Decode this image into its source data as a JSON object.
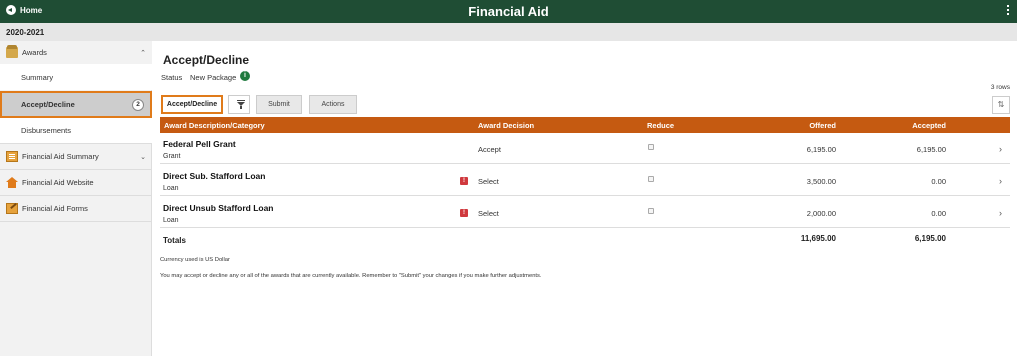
{
  "header": {
    "home_label": "Home",
    "title": "Financial Aid"
  },
  "subheader": {
    "year": "2020-2021"
  },
  "sidebar": {
    "awards_label": "Awards",
    "summary_label": "Summary",
    "accept_decline_label": "Accept/Decline",
    "accept_decline_badge": "2",
    "disbursements_label": "Disbursements",
    "fa_summary_label": "Financial Aid Summary",
    "fa_website_label": "Financial Aid Website",
    "fa_forms_label": "Financial Aid Forms"
  },
  "main": {
    "title": "Accept/Decline",
    "status_label": "Status",
    "status_value": "New Package",
    "row_count": "3 rows"
  },
  "toolbar": {
    "accept_decline": "Accept/Decline",
    "submit": "Submit",
    "actions": "Actions"
  },
  "grid": {
    "headers": {
      "description": "Award Description/Category",
      "decision": "Award Decision",
      "reduce": "Reduce",
      "offered": "Offered",
      "accepted": "Accepted"
    },
    "rows": [
      {
        "title": "Federal Pell Grant",
        "category": "Grant",
        "decision": "Accept",
        "offered": "6,195.00",
        "accepted": "6,195.00",
        "error": false
      },
      {
        "title": "Direct Sub. Stafford Loan",
        "category": "Loan",
        "decision": "Select",
        "offered": "3,500.00",
        "accepted": "0.00",
        "error": true
      },
      {
        "title": "Direct Unsub Stafford Loan",
        "category": "Loan",
        "decision": "Select",
        "offered": "2,000.00",
        "accepted": "0.00",
        "error": true
      }
    ],
    "totals": {
      "label": "Totals",
      "offered": "11,695.00",
      "accepted": "6,195.00"
    }
  },
  "notes": {
    "currency": "Currency used is US Dollar",
    "instructions": "You may accept or decline any or all of the awards that are currently available. Remember to \"Submit\" your changes if you make further adjustments."
  },
  "colors": {
    "header_bg": "#1f4d34",
    "grid_header_bg": "#c55a11",
    "active_outline": "#e07b1a",
    "error_red": "#d0393e"
  },
  "icons": {
    "home": "back-arrow-icon",
    "menu": "kebab-menu-icon",
    "awards": "award-icon",
    "fa_summary": "summary-document-icon",
    "fa_website": "house-icon",
    "fa_forms": "forms-icon",
    "status_info": "info-icon",
    "filter": "filter-icon",
    "sort": "sort-icon",
    "row_nav": "chevron-right-icon",
    "error": "error-icon"
  }
}
